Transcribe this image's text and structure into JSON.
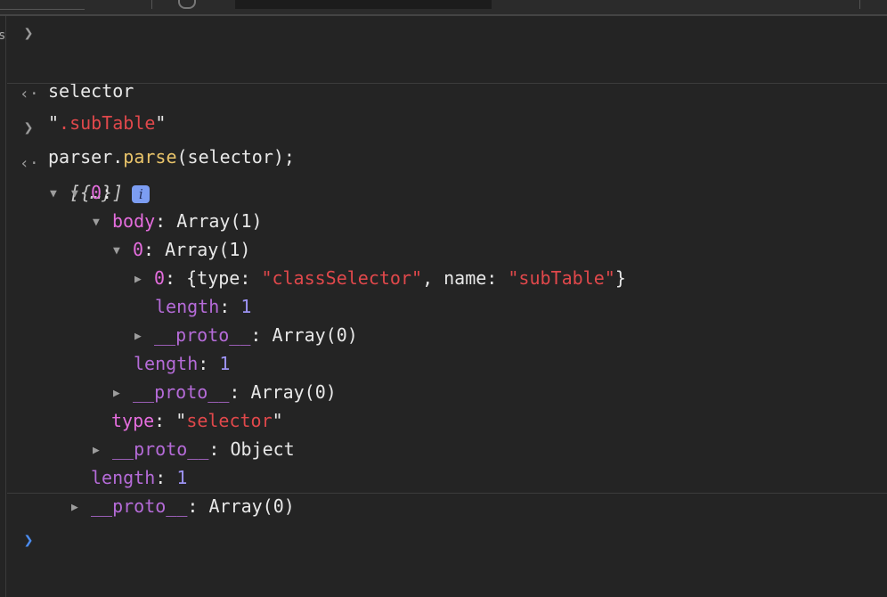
{
  "console": {
    "line1": {
      "input": "selector"
    },
    "line2": {
      "result_quote_open": "\"",
      "result_value": ".subTable",
      "result_quote_close": "\""
    },
    "line3": {
      "obj": "parser",
      "dot": ".",
      "fn": "parse",
      "args": "(selector);"
    },
    "tree": {
      "root_label": "[{…}]",
      "info_badge": "i",
      "item0_key": "0",
      "body_key": "body",
      "body_value": "Array(1)",
      "body0_key": "0",
      "body0_value": "Array(1)",
      "inner0_key": "0",
      "inner0_open": "{type: ",
      "inner0_type": "\"classSelector\"",
      "inner0_mid": ", name: ",
      "inner0_name": "\"subTable\"",
      "inner0_close": "}",
      "inner_length_key": "length",
      "inner_length_val": "1",
      "inner_proto_key": "__proto__",
      "inner_proto_val": "Array(0)",
      "body0_length_key": "length",
      "body0_length_val": "1",
      "body0_proto_key": "__proto__",
      "body0_proto_val": "Array(0)",
      "type_key": "type",
      "type_val_open": "\"",
      "type_val": "selector",
      "type_val_close": "\"",
      "item_proto_key": "__proto__",
      "item_proto_val": "Object",
      "root_length_key": "length",
      "root_length_val": "1",
      "root_proto_key": "__proto__",
      "root_proto_val": "Array(0)"
    },
    "colon": ":",
    "colors": {
      "background": "#242424",
      "key_pink": "#e46ddd",
      "key_purple": "#b56bd8",
      "string_red": "#e0484b",
      "number_violet": "#9d93f4",
      "function_yellow": "#e9c46a",
      "prompt_blue": "#4b8cf0"
    }
  }
}
